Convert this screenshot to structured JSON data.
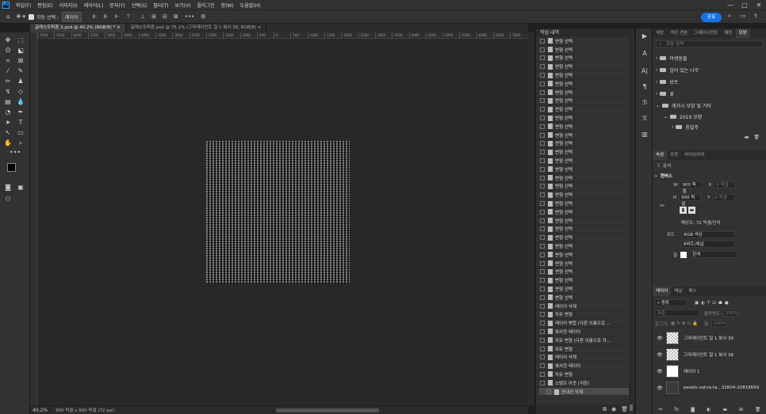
{
  "app": {
    "logo": "Ps"
  },
  "menu": [
    "파일(F)",
    "편집(E)",
    "이미지(I)",
    "레이어(L)",
    "문자(Y)",
    "선택(S)",
    "필터(T)",
    "보기(V)",
    "플러그인",
    "창(W)",
    "도움말(H)"
  ],
  "window_controls": [
    "—",
    "□",
    "✕"
  ],
  "options": {
    "auto_select_label": "자동 선택 :",
    "auto_select_value": "레이어",
    "more": "•••",
    "share_label": "공유"
  },
  "doc_tabs": [
    {
      "label": "글래스모피즘 2.psd @ 40.2% (RGB/8) *",
      "close": "×"
    },
    {
      "label": "글래스모피즘.psd @ 75.1% (그라데이언트 칠 1 복사 38, RGB/8)",
      "close": "×"
    }
  ],
  "ruler_top": [
    "7000",
    "6500",
    "6000",
    "5500",
    "5000",
    "4500",
    "4000",
    "3500",
    "3000",
    "2500",
    "2000",
    "1500",
    "1000",
    "500",
    "0",
    "500",
    "1000",
    "1500",
    "2000",
    "2500",
    "3000",
    "3500",
    "4000",
    "4500",
    "5000",
    "5500",
    "6000",
    "6500",
    "7000"
  ],
  "status": {
    "zoom": "40.2%",
    "doc_info": "900 픽셀 x 900 픽셀 (72 ppi)"
  },
  "history": {
    "title": "작업 내역",
    "items": [
      "변형 선택",
      "변형 선택",
      "변형 선택",
      "변형 선택",
      "변형 선택",
      "변형 선택",
      "변형 선택",
      "변형 선택",
      "변형 선택",
      "변형 선택",
      "변형 선택",
      "변형 선택",
      "변형 선택",
      "변형 선택",
      "변형 선택",
      "변형 선택",
      "변형 선택",
      "변형 선택",
      "변형 선택",
      "변형 선택",
      "변형 선택",
      "변형 선택",
      "변형 선택",
      "변형 선택",
      "변형 선택",
      "변형 선택",
      "변형 선택",
      "변형 선택",
      "변형 선택",
      "변형 선택",
      "변형 선택",
      "레이어 삭제",
      "자유 변형",
      "레이어 병합 (다른 이름으로 ...",
      "복사한 레이어",
      "자유 변형 (다른 이름으로 자...",
      "자유 변형",
      "레이어 삭제",
      "복사한 레이어",
      "자유 변형",
      "스탬프 아웃 (저장)",
      "안내선 삭제"
    ],
    "selected_index": 41
  },
  "shapes_panel": {
    "tabs": [
      "색상",
      "색상 견본",
      "그레이디언트",
      "패턴",
      "모양"
    ],
    "active_tab": 4,
    "search_placeholder": "모양 검색",
    "groups": [
      "야생동물",
      "잎이 있는 나무",
      "보트",
      "꽃",
      "레거시 모양 및 기타"
    ],
    "subgroups": [
      "2019 모양",
      "칭얼주"
    ]
  },
  "properties": {
    "tabs": [
      "속성",
      "조정",
      "라이브러리"
    ],
    "doc_label": "문서",
    "section": "캔버스",
    "w_label": "W",
    "w_value": "900 픽셀",
    "h_label": "H",
    "h_value": "900 픽셀",
    "x_label": "X",
    "x_placeholder": "0 픽셀",
    "y_label": "Y",
    "y_placeholder": "0 픽셀",
    "resolution": "해상도: 72 픽셀/인치",
    "mode_label": "모드",
    "mode_value": "RGB 색상",
    "depth_value": "8비트/채널",
    "fill_label": "칠",
    "fill_value": "흰색"
  },
  "layers_panel": {
    "tabs": [
      "레이어",
      "채널",
      "패스"
    ],
    "filter_value": "종류",
    "blend_value": "표준",
    "opacity_label": "불투명도:",
    "opacity_value": "100%",
    "lock_label": "잠그기:",
    "fill_label": "칠:",
    "fill_value": "100%",
    "layers": [
      {
        "name": "그라데이언트 칠 1 복사 39"
      },
      {
        "name": "그라데이언트 칠 1 복사 38"
      },
      {
        "name": "레이어 1"
      },
      {
        "name": "pexels-zahra-ta...32604-20818669"
      }
    ]
  }
}
